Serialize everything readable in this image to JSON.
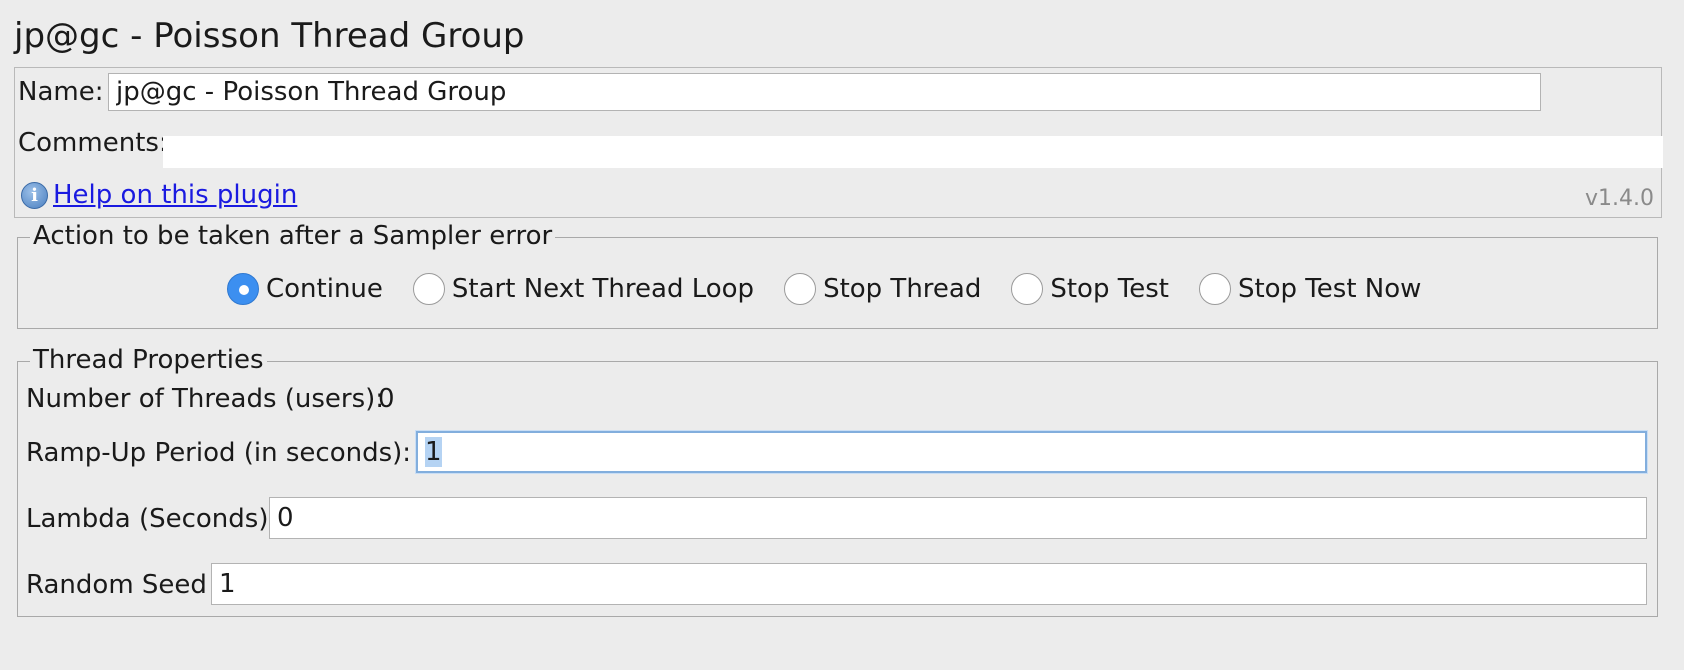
{
  "header": {
    "title": "jp@gc - Poisson Thread Group"
  },
  "name_panel": {
    "name_label": "Name:",
    "name_value": "jp@gc - Poisson Thread Group",
    "comments_label": "Comments:",
    "comments_value": "",
    "help_icon": "info-icon",
    "help_link": "Help on this plugin",
    "version": "v1.4.0"
  },
  "sampler_error": {
    "title": "Action to be taken after a Sampler error",
    "selected": "Continue",
    "options": [
      "Continue",
      "Start Next Thread Loop",
      "Stop Thread",
      "Stop Test",
      "Stop Test Now"
    ]
  },
  "thread_properties": {
    "title": "Thread Properties",
    "threads_label": "Number of Threads (users):",
    "threads_value": "0",
    "rampup_label": "Ramp-Up Period (in seconds):",
    "rampup_value": "1",
    "lambda_label": "Lambda (Seconds)",
    "lambda_value": "0",
    "seed_label": "Random Seed",
    "seed_value": "1"
  },
  "colors": {
    "background": "#ececec",
    "link": "#1a1ae0",
    "radio_selected": "#3c8ff0",
    "focus_border": "#82aedd",
    "version_text": "#8a8a8a"
  }
}
